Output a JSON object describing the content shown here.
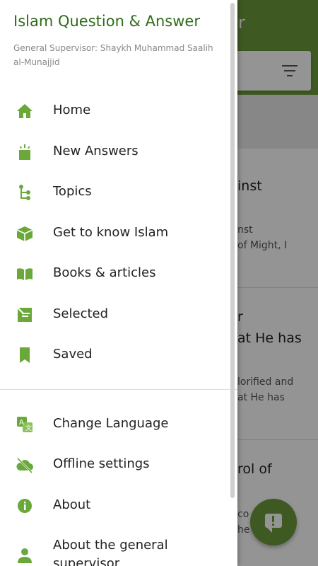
{
  "colors": {
    "primary": "#6b9a3a",
    "drawer_title": "#2f6b1a",
    "icon": "#6aa83a"
  },
  "background_app": {
    "appbar_title_fragment": "swer",
    "cards": [
      {
        "title_fragment": "inst",
        "snippet_lines": [
          "nst",
          "of Might, I"
        ]
      },
      {
        "title_fragments": [
          "r",
          "at He has"
        ],
        "snippet_lines": [
          "lorified and",
          "at He has"
        ]
      },
      {
        "title_fragment": "rol of",
        "snippet_lines": [
          "co",
          "he e"
        ]
      }
    ]
  },
  "drawer": {
    "title": "Islam Question & Answer",
    "subtitle": "General Supervisor: Shaykh Muhammad Saalih al-Munajjid",
    "items": [
      {
        "label": "Home",
        "icon": "home-icon"
      },
      {
        "label": "New Answers",
        "icon": "new-answers-icon"
      },
      {
        "label": "Topics",
        "icon": "topics-tree-icon"
      },
      {
        "label": "Get to know Islam",
        "icon": "box-icon"
      },
      {
        "label": "Books & articles",
        "icon": "book-icon"
      },
      {
        "label": "Selected",
        "icon": "selected-icon"
      },
      {
        "label": "Saved",
        "icon": "bookmark-icon"
      }
    ],
    "secondary_items": [
      {
        "label": "Change Language",
        "icon": "translate-icon"
      },
      {
        "label": "Offline settings",
        "icon": "cloud-off-icon"
      },
      {
        "label": "About",
        "icon": "info-icon"
      },
      {
        "label": "About the general supervisor",
        "icon": "person-icon"
      }
    ]
  }
}
